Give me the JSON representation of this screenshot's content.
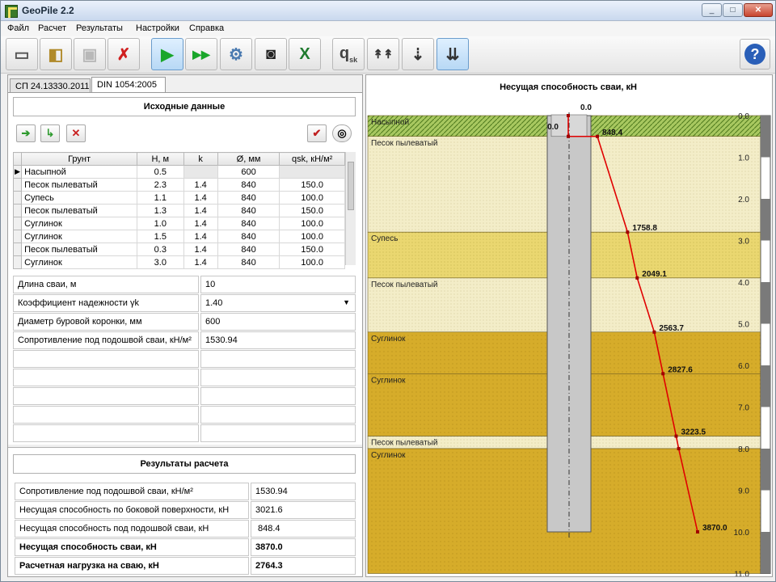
{
  "window": {
    "title": "GeoPile 2.2",
    "min": "_",
    "max": "□",
    "close": "✕"
  },
  "menu": [
    "Файл",
    "Расчет",
    "Результаты",
    "Настройки",
    "Справка"
  ],
  "toolbar": {
    "buttons": [
      {
        "name": "new-file-button",
        "icon": "new-document-icon",
        "glyph": "▭"
      },
      {
        "name": "open-file-button",
        "icon": "open-folder-icon",
        "glyph": "◧"
      },
      {
        "name": "save-file-button",
        "icon": "save-disk-icon",
        "glyph": "▣"
      },
      {
        "name": "close-file-button",
        "icon": "close-file-icon",
        "glyph": "✗"
      },
      {
        "name": "run-button",
        "icon": "play-icon",
        "glyph": "▶"
      },
      {
        "name": "run-all-button",
        "icon": "fast-forward-icon",
        "glyph": "▶▶"
      },
      {
        "name": "settings-button",
        "icon": "gear-icon",
        "glyph": "⚙"
      },
      {
        "name": "screenshot-button",
        "icon": "camera-icon",
        "glyph": "◙"
      },
      {
        "name": "export-excel-button",
        "icon": "excel-icon",
        "glyph": "X"
      },
      {
        "name": "qsk-button",
        "icon": "qsk-icon",
        "glyph": "q",
        "sub": "sk"
      },
      {
        "name": "view-arrows-button",
        "icon": "arrows-up-icon",
        "glyph": "↟↟"
      },
      {
        "name": "view-single-pile-button",
        "icon": "pile-icon",
        "glyph": "⇣"
      },
      {
        "name": "view-pile-load-button",
        "icon": "pile-load-icon",
        "glyph": "⇊"
      },
      {
        "name": "help-button",
        "icon": "help-icon",
        "glyph": "?"
      }
    ]
  },
  "tabs": [
    "СП 24.13330.2011",
    "DIN 1054:2005"
  ],
  "input": {
    "header": "Исходные данные",
    "columns": [
      "Грунт",
      "H, м",
      "k",
      "Ø, мм",
      "qsk, кН/м²"
    ],
    "rows": [
      [
        "Насыпной",
        "0.5",
        "",
        "600",
        ""
      ],
      [
        "Песок пылеватый",
        "2.3",
        "1.4",
        "840",
        "150.0"
      ],
      [
        "Супесь",
        "1.1",
        "1.4",
        "840",
        "100.0"
      ],
      [
        "Песок пылеватый",
        "1.3",
        "1.4",
        "840",
        "150.0"
      ],
      [
        "Суглинок",
        "1.0",
        "1.4",
        "840",
        "100.0"
      ],
      [
        "Суглинок",
        "1.5",
        "1.4",
        "840",
        "100.0"
      ],
      [
        "Песок пылеватый",
        "0.3",
        "1.4",
        "840",
        "150.0"
      ],
      [
        "Суглинок",
        "3.0",
        "1.4",
        "840",
        "100.0"
      ]
    ],
    "params": [
      {
        "label": "Длина сваи, м",
        "value": "10"
      },
      {
        "label": "Коэффициент надежности γk",
        "value": "1.40"
      },
      {
        "label": "Диаметр буровой коронки, мм",
        "value": "600"
      },
      {
        "label": "Сопротивление под подошвой сваи, кН/м²",
        "value": "1530.94"
      }
    ]
  },
  "results": {
    "header": "Результаты расчета",
    "rows": [
      {
        "label": "Сопротивление под подошвой сваи, кН/м²",
        "value": "1530.94",
        "bold": false
      },
      {
        "label": "Несущая способность по боковой поверхности, кН",
        "value": "3021.6",
        "bold": false
      },
      {
        "label": "Несущая способность под подошвой сваи, кН",
        "value": "848.4",
        "bold": false
      },
      {
        "label": "Несущая способность сваи, кН",
        "value": "3870.0",
        "bold": true
      },
      {
        "label": "Расчетная нагрузка на сваю, кН",
        "value": "2764.3",
        "bold": true
      }
    ]
  },
  "colors": {
    "fill": "#8fb84a",
    "sand": "#f3edc8",
    "sandyloam": "#ead770",
    "loam": "#d6ac2a",
    "line": "#e00000"
  },
  "chart_data": {
    "type": "line",
    "title": "Несущая способность сваи, кН",
    "ylabel": "",
    "xlabel": "",
    "ylim": [
      0,
      11
    ],
    "yticks": [
      "0.0",
      "1.0",
      "2.0",
      "3.0",
      "4.0",
      "5.0",
      "6.0",
      "7.0",
      "8.0",
      "9.0",
      "10.0",
      "11.0"
    ],
    "layers": [
      {
        "name": "Насыпной",
        "top": 0,
        "bottom": 0.5,
        "color": "fill"
      },
      {
        "name": "Песок пылеватый",
        "top": 0.5,
        "bottom": 2.8,
        "color": "sand"
      },
      {
        "name": "Супесь",
        "top": 2.8,
        "bottom": 3.9,
        "color": "sandyloam"
      },
      {
        "name": "Песок пылеватый",
        "top": 3.9,
        "bottom": 5.2,
        "color": "sand"
      },
      {
        "name": "Суглинок",
        "top": 5.2,
        "bottom": 6.2,
        "color": "loam"
      },
      {
        "name": "Суглинок",
        "top": 6.2,
        "bottom": 7.7,
        "color": "loam"
      },
      {
        "name": "Песок пылеватый",
        "top": 7.7,
        "bottom": 8.0,
        "color": "sand"
      },
      {
        "name": "Суглинок",
        "top": 8.0,
        "bottom": 11.0,
        "color": "loam"
      }
    ],
    "pile": {
      "top": 0,
      "bottom": 10.0
    },
    "series": [
      {
        "values": [
          {
            "depth": 0.0,
            "value": 0.0,
            "label": "0.0"
          },
          {
            "depth": 0.0,
            "value": 0.0,
            "label": "0.0"
          },
          {
            "depth": 0.5,
            "value": 0.0,
            "label": ""
          },
          {
            "depth": 0.5,
            "value": 848.4,
            "label": "848.4"
          },
          {
            "depth": 2.8,
            "value": 1758.8,
            "label": "1758.8"
          },
          {
            "depth": 3.9,
            "value": 2049.1,
            "label": "2049.1"
          },
          {
            "depth": 5.2,
            "value": 2563.7,
            "label": "2563.7"
          },
          {
            "depth": 6.2,
            "value": 2827.6,
            "label": "2827.6"
          },
          {
            "depth": 7.7,
            "value": 3223.5,
            "label": "3223.5"
          },
          {
            "depth": 8.0,
            "value": 3300.0,
            "label": ""
          },
          {
            "depth": 10.0,
            "value": 3870.0,
            "label": "3870.0"
          }
        ]
      }
    ]
  }
}
